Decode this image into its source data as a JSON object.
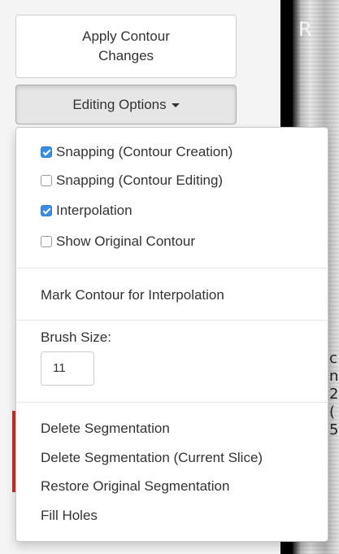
{
  "buttons": {
    "apply_line1": "Apply Contour",
    "apply_line2": "Changes",
    "editing_options": "Editing Options"
  },
  "menu": {
    "checkboxes": [
      {
        "label": "Snapping (Contour Creation)",
        "checked": true
      },
      {
        "label": "Snapping (Contour Editing)",
        "checked": false
      },
      {
        "label": "Interpolation",
        "checked": true
      },
      {
        "label": "Show Original Contour",
        "checked": false
      }
    ],
    "mark_contour": "Mark Contour for Interpolation",
    "brush_label": "Brush Size:",
    "brush_value": "11",
    "actions": [
      "Delete Segmentation",
      "Delete Segmentation (Current Slice)",
      "Restore Original Segmentation",
      "Fill Holes"
    ]
  },
  "viewer": {
    "corner_letter": "R",
    "side_text": [
      "c",
      "n",
      "2",
      "(",
      "5"
    ]
  },
  "colors": {
    "accent": "#3b8de0",
    "red_mark": "#c9302c"
  }
}
